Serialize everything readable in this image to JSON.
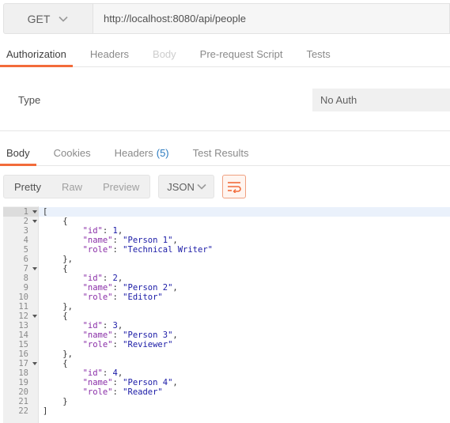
{
  "request": {
    "method": "GET",
    "url": "http://localhost:8080/api/people"
  },
  "request_tabs": [
    {
      "label": "Authorization",
      "state": "active"
    },
    {
      "label": "Headers",
      "state": "normal"
    },
    {
      "label": "Body",
      "state": "disabled"
    },
    {
      "label": "Pre-request Script",
      "state": "normal"
    },
    {
      "label": "Tests",
      "state": "normal"
    }
  ],
  "auth": {
    "type_label": "Type",
    "type_value": "No Auth"
  },
  "response_tabs": [
    {
      "label": "Body",
      "state": "active",
      "count": ""
    },
    {
      "label": "Cookies",
      "state": "normal",
      "count": ""
    },
    {
      "label": "Headers",
      "state": "normal",
      "count": "(5)"
    },
    {
      "label": "Test Results",
      "state": "normal",
      "count": ""
    }
  ],
  "view_modes": [
    "Pretty",
    "Raw",
    "Preview"
  ],
  "active_view_mode": "Pretty",
  "format": "JSON",
  "icons": {
    "method_dropdown": "chevron-down-icon",
    "format_dropdown": "chevron-down-icon",
    "wrap": "wrap-lines-icon",
    "fold": "fold-arrow-icon"
  },
  "colors": {
    "accent": "#f26b3a",
    "count": "#2a7ac0",
    "json_key": "#8a2fa8",
    "json_string": "#1a1aa6",
    "current_line": "#eaf1fb"
  },
  "response_lines": [
    {
      "n": "1",
      "fold": true,
      "text": "["
    },
    {
      "n": "2",
      "fold": true,
      "text": "    {"
    },
    {
      "n": "3",
      "fold": false,
      "text": "        \"id\": 1,"
    },
    {
      "n": "4",
      "fold": false,
      "text": "        \"name\": \"Person 1\","
    },
    {
      "n": "5",
      "fold": false,
      "text": "        \"role\": \"Technical Writer\""
    },
    {
      "n": "6",
      "fold": false,
      "text": "    },"
    },
    {
      "n": "7",
      "fold": true,
      "text": "    {"
    },
    {
      "n": "8",
      "fold": false,
      "text": "        \"id\": 2,"
    },
    {
      "n": "9",
      "fold": false,
      "text": "        \"name\": \"Person 2\","
    },
    {
      "n": "10",
      "fold": false,
      "text": "        \"role\": \"Editor\""
    },
    {
      "n": "11",
      "fold": false,
      "text": "    },"
    },
    {
      "n": "12",
      "fold": true,
      "text": "    {"
    },
    {
      "n": "13",
      "fold": false,
      "text": "        \"id\": 3,"
    },
    {
      "n": "14",
      "fold": false,
      "text": "        \"name\": \"Person 3\","
    },
    {
      "n": "15",
      "fold": false,
      "text": "        \"role\": \"Reviewer\""
    },
    {
      "n": "16",
      "fold": false,
      "text": "    },"
    },
    {
      "n": "17",
      "fold": true,
      "text": "    {"
    },
    {
      "n": "18",
      "fold": false,
      "text": "        \"id\": 4,"
    },
    {
      "n": "19",
      "fold": false,
      "text": "        \"name\": \"Person 4\","
    },
    {
      "n": "20",
      "fold": false,
      "text": "        \"role\": \"Reader\""
    },
    {
      "n": "21",
      "fold": false,
      "text": "    }"
    },
    {
      "n": "22",
      "fold": false,
      "text": "]"
    }
  ]
}
